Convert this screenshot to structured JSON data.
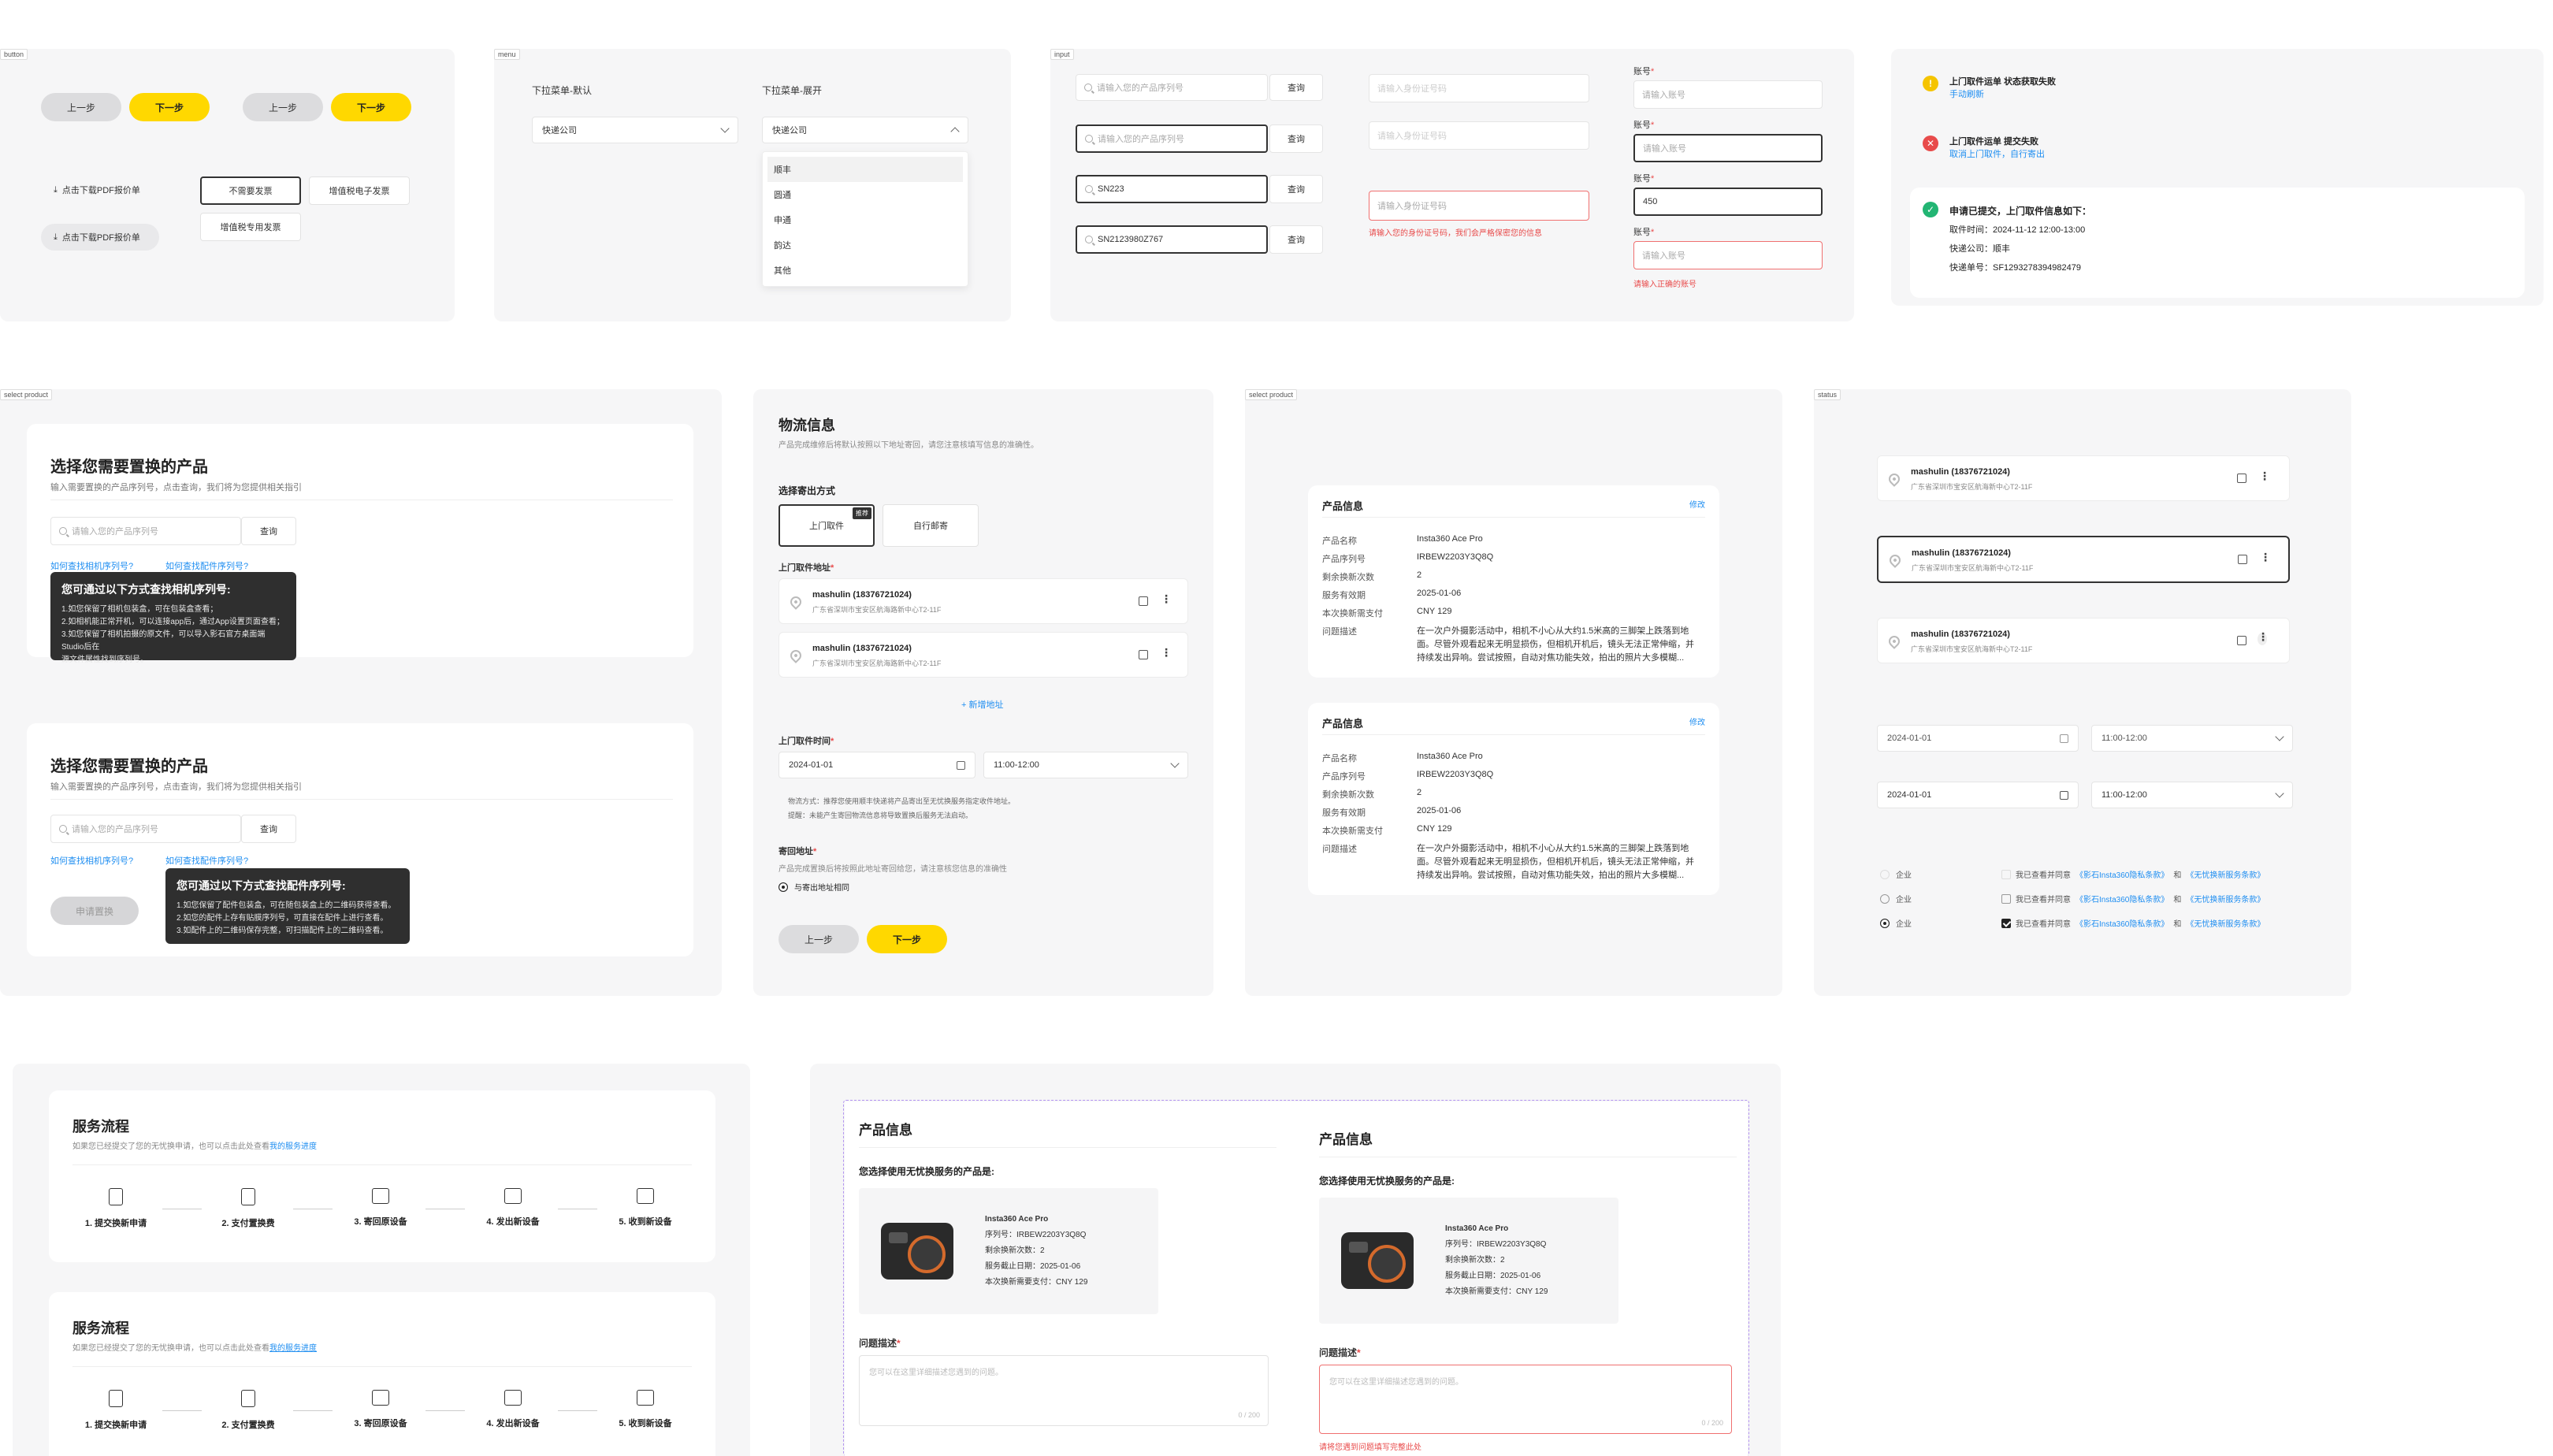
{
  "button": {
    "frame_label": "button",
    "prev": "上一步",
    "next": "下一步",
    "download_pdf": "点击下载PDF报价单",
    "no_invoice": "不需要发票",
    "vat_electronic": "增值税电子发票",
    "vat_special": "增值税专用发票"
  },
  "menu": {
    "frame_label": "menu",
    "default_title": "下拉菜单-默认",
    "expanded_title": "下拉菜单-展开",
    "select_value": "快递公司",
    "options": [
      "顺丰",
      "圆通",
      "申通",
      "韵达",
      "其他"
    ]
  },
  "input": {
    "frame_label": "input",
    "sn_placeholder": "请输入您的产品序列号",
    "query": "查询",
    "sn_partial": "SN223",
    "sn_full": "SN2123980Z767",
    "id_placeholder": "请输入身份证号码",
    "id_error": "请输入您的身份证号码，我们会严格保密您的信息",
    "account_label": "账号",
    "account_placeholder": "请输入账号",
    "account_value": "450",
    "account_error": "请输入正确的账号"
  },
  "status": {
    "s1_title": "上门取件运单 状态获取失败",
    "s1_link": "手动刷新",
    "s2_title": "上门取件运单 提交失败",
    "s2_link": "取消上门取件，自行寄出",
    "s3_title": "申请已提交，上门取件信息如下：",
    "s3_lines": [
      "取件时间：2024-11-12 12:00-13:00",
      "快递公司：顺丰",
      "快递单号：SF1293278394982479"
    ]
  },
  "select_product": {
    "frame_label": "select product",
    "title": "选择您需要置换的产品",
    "desc": "输入需要置换的产品序列号，点击查询，我们将为您提供相关指引",
    "placeholder": "请输入您的产品序列号",
    "query": "查询",
    "link_camera": "如何查找相机序列号?",
    "link_accessory": "如何查找配件序列号?",
    "tt1_title": "您可通过以下方式查找相机序列号:",
    "tt1_lines": [
      "1.如您保留了相机包装盒，可在包装盒查看；",
      "2.如相机能正常开机，可以连接app后，通过App设置页面查看；",
      "3.如您保留了相机拍摄的原文件，可以导入影石官方桌面端Studio后在",
      "源文件属性找到序列号。"
    ],
    "tt2_title": "您可通过以下方式查找配件序列号:",
    "tt2_lines": [
      "1.如您保留了配件包装盒，可在随包装盒上的二维码获得查看。",
      "2.如您的配件上存有贴膜序列号，可直接在配件上进行查看。",
      "3.如配件上的二维码保存完整，可扫描配件上的二维码查看。"
    ],
    "apply": "申请置换"
  },
  "logistics": {
    "title": "物流信息",
    "desc": "产品完成维修后将默认按照以下地址寄回，请您注意核填写信息的准确性。",
    "method_label": "选择寄出方式",
    "pickup": "上门取件",
    "recommend": "推荐",
    "self_send": "自行邮寄",
    "pickup_addr_label": "上门取件地址",
    "addr_name": "mashulin (18376721024)",
    "addr_detail": "广东省深圳市宝安区航海路新中心T2-11F",
    "add_addr": "+ 新增地址",
    "time_label": "上门取件时间",
    "date": "2024-01-01",
    "time": "11:00-12:00",
    "note1": "物流方式：推荐您使用顺丰快递将产品寄出至无忧换服务指定收件地址。",
    "note2": "提醒：未能产生寄回物流信息将导致置换后服务无法启动。",
    "return_label": "寄回地址",
    "return_desc": "产品完成置换后将按照此地址寄回给您，请注意核您信息的准确性",
    "same_addr": "与寄出地址相同",
    "prev": "上一步",
    "next": "下一步"
  },
  "product_info": {
    "frame_label": "select product",
    "title": "产品信息",
    "edit": "修改",
    "rows": [
      {
        "k": "产品名称",
        "v": "Insta360 Ace Pro"
      },
      {
        "k": "产品序列号",
        "v": "IRBEW2203Y3Q8Q"
      },
      {
        "k": "剩余换新次数",
        "v": "2"
      },
      {
        "k": "服务有效期",
        "v": "2025-01-06"
      },
      {
        "k": "本次换新需支付",
        "v": "CNY 129"
      }
    ],
    "desc_key": "问题描述",
    "desc_lines": [
      "在一次户外摄影活动中，相机不小心从大约1.5米高的三脚架上跌落到地",
      "面。尽管外观看起来无明显损伤，但相机开机后，镜头无法正常伸缩，并",
      "持续发出异响。尝试按照，自动对焦功能失效，拍出的照片大多模糊..."
    ]
  },
  "status2": {
    "frame_label": "status",
    "addr_name": "mashulin (18376721024)",
    "addr_detail": "广东省深圳市宝安区航海新中心T2-11F",
    "date": "2024-01-01",
    "time": "11:00-12:00",
    "company": "企业",
    "agree_prefix": "我已查看并同意",
    "agree_link1": "《影石Insta360隐私条款》",
    "agree_and": "和",
    "agree_link2": "《无忧换新服务条款》"
  },
  "service": {
    "title": "服务流程",
    "desc": "如果您已经提交了您的无忧换申请，也可以点击此处查看",
    "desc_link": "我的服务进度",
    "steps": [
      "1. 提交换新申请",
      "2. 支付置换费",
      "3. 寄回原设备",
      "4. 发出新设备",
      "5. 收到新设备"
    ]
  },
  "product_panel": {
    "title": "产品信息",
    "chosen_label": "您选择使用无忧换服务的产品是:",
    "name": "Insta360 Ace Pro",
    "lines": [
      "序列号：IRBEW2203Y3Q8Q",
      "剩余换新次数：2",
      "服务截止日期：2025-01-06",
      "本次换新需要支付：CNY 129"
    ],
    "problem_label": "问题描述",
    "placeholder": "您可以在这里详细描述您遇到的问题。",
    "count": "0 / 200",
    "error": "请将您遇到问题填写完整此处"
  },
  "colors": {
    "accent": "#ffd800",
    "link": "#1f8ef1",
    "error": "#e84b4b",
    "success": "#22b573",
    "warning": "#f5c400"
  }
}
